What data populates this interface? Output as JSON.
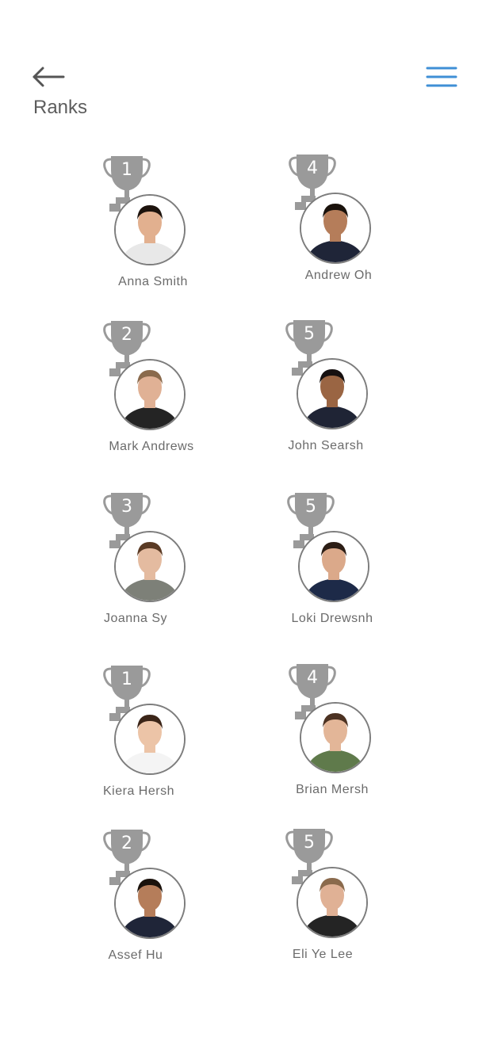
{
  "header": {
    "back_icon": "arrow-left-icon",
    "menu_icon": "hamburger-menu-icon",
    "menu_color": "#3f8fd6",
    "title": "Ranks"
  },
  "players": [
    {
      "rank": "1",
      "name": "Anna Smith",
      "skin": "#e2b08f",
      "hair": "#1d130d",
      "shirt": "#e8e8e8",
      "bg": "#ffffff"
    },
    {
      "rank": "4",
      "name": "Andrew Oh",
      "skin": "#b57d5a",
      "hair": "#1a120c",
      "shirt": "#1f2538",
      "bg": "#ffffff"
    },
    {
      "rank": "2",
      "name": "Mark Andrews",
      "skin": "#e0b195",
      "hair": "#8a6a4c",
      "shirt": "#242424",
      "bg": "#ffffff"
    },
    {
      "rank": "5",
      "name": "John Searsh",
      "skin": "#9a6543",
      "hair": "#161010",
      "shirt": "#1f2435",
      "bg": "#ffffff"
    },
    {
      "rank": "3",
      "name": "Joanna Sy",
      "skin": "#e4bba0",
      "hair": "#5a3a24",
      "shirt": "#7d8078",
      "bg": "#ffffff"
    },
    {
      "rank": "5",
      "name": "Loki Drewsnh",
      "skin": "#dba98a",
      "hair": "#2b1d15",
      "shirt": "#1d2a48",
      "bg": "#ffffff"
    },
    {
      "rank": "1",
      "name": "Kiera Hersh",
      "skin": "#ecc4a7",
      "hair": "#3b2518",
      "shirt": "#f4f4f4",
      "bg": "#ffffff"
    },
    {
      "rank": "4",
      "name": "Brian Mersh",
      "skin": "#e3b698",
      "hair": "#4c3222",
      "shirt": "#5f7a4b",
      "bg": "#ffffff"
    },
    {
      "rank": "2",
      "name": "Assef Hu",
      "skin": "#b57d5a",
      "hair": "#1a120c",
      "shirt": "#1f2538",
      "bg": "#ffffff"
    },
    {
      "rank": "5",
      "name": "Eli Ye Lee",
      "skin": "#e0b195",
      "hair": "#8a6a4c",
      "shirt": "#242424",
      "bg": "#ffffff"
    }
  ],
  "colors": {
    "trophy": "#9a9a9a",
    "avatar_border": "#7d7d7d"
  }
}
